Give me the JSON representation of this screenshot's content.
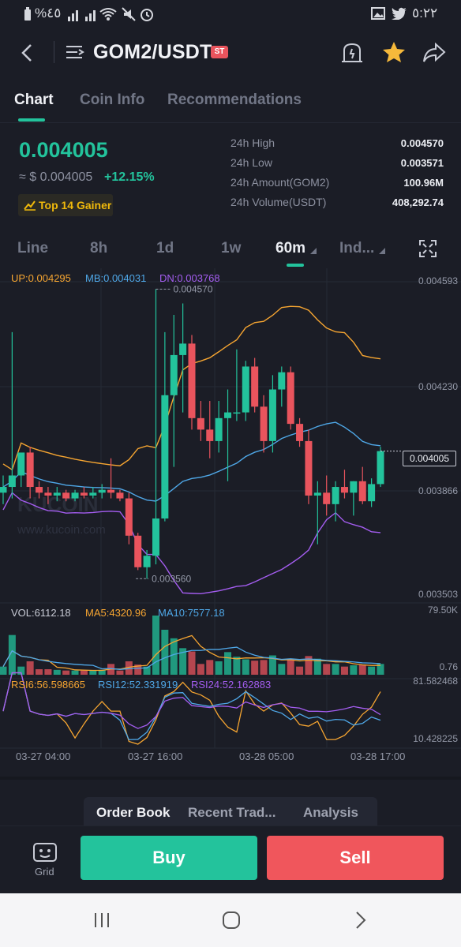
{
  "status_bar": {
    "left_text": "%٤٥",
    "time": "٥:٢٢"
  },
  "header": {
    "pair": "GOM2/USDT",
    "badge": "ST"
  },
  "tabs": [
    {
      "label": "Chart",
      "active": true
    },
    {
      "label": "Coin Info",
      "active": false
    },
    {
      "label": "Recommendations",
      "active": false
    }
  ],
  "ticker": {
    "price": "0.004005",
    "fiat": "≈ $ 0.004005",
    "change": "+12.15%",
    "gainer_label": "Top 14 Gainer"
  },
  "stats": [
    {
      "label": "24h High",
      "value": "0.004570"
    },
    {
      "label": "24h Low",
      "value": "0.003571"
    },
    {
      "label": "24h Amount(GOM2)",
      "value": "100.96M"
    },
    {
      "label": "24h Volume(USDT)",
      "value": "408,292.74"
    }
  ],
  "intervals": [
    {
      "label": "Line",
      "active": false
    },
    {
      "label": "8h",
      "active": false
    },
    {
      "label": "1d",
      "active": false
    },
    {
      "label": "1w",
      "active": false
    },
    {
      "label": "60m",
      "active": true
    },
    {
      "label": "Ind...",
      "active": false
    }
  ],
  "chart": {
    "boll_up": "UP:0.004295",
    "boll_mb": "MB:0.004031",
    "boll_dn": "DN:0.003768",
    "y_axis": [
      "0.004593",
      "0.004230",
      "0.003866",
      "0.003503"
    ],
    "current_price_tag": "0.004005",
    "high_marker": "0.004570",
    "low_marker": "0.003560",
    "watermark_logo": "KUCOIN",
    "watermark_url": "www.kucoin.com",
    "vol": "VOL:6112.18",
    "ma5": "MA5:4320.96",
    "ma10": "MA10:7577.18",
    "vol_axis_top": "79.50K",
    "vol_axis_bottom": "0.76",
    "rsi6": "RSI6:56.598665",
    "rsi12": "RSI12:52.331919",
    "rsi24": "RSI24:52.162883",
    "rsi_axis_top": "81.582468",
    "rsi_axis_bottom": "10.428225",
    "time_labels": [
      "03-27 04:00",
      "03-27 16:00",
      "03-28 05:00",
      "03-28 17:00"
    ]
  },
  "bottom_tabs": [
    {
      "label": "Order Book",
      "active": true
    },
    {
      "label": "Recent Trad...",
      "active": false
    },
    {
      "label": "Analysis",
      "active": false
    }
  ],
  "actions": {
    "grid_label": "Grid",
    "buy_label": "Buy",
    "sell_label": "Sell"
  },
  "colors": {
    "up": "#23c39c",
    "down": "#e9545d",
    "boll_up": "#f6a531",
    "boll_mb": "#4fa8e8",
    "boll_dn": "#a45df0",
    "background": "#1b1d26"
  },
  "chart_data": {
    "type": "candlestick",
    "y_range": [
      0.003503,
      0.004593
    ],
    "candles": [
      {
        "o": 0.00386,
        "h": 0.00392,
        "l": 0.00382,
        "c": 0.00388
      },
      {
        "o": 0.00388,
        "h": 0.00442,
        "l": 0.00384,
        "c": 0.00392
      },
      {
        "o": 0.00392,
        "h": 0.00398,
        "l": 0.00388,
        "c": 0.004
      },
      {
        "o": 0.004,
        "h": 0.00402,
        "l": 0.00384,
        "c": 0.00388
      },
      {
        "o": 0.00388,
        "h": 0.0039,
        "l": 0.00384,
        "c": 0.00386
      },
      {
        "o": 0.00386,
        "h": 0.00388,
        "l": 0.00382,
        "c": 0.00385
      },
      {
        "o": 0.00385,
        "h": 0.00388,
        "l": 0.00383,
        "c": 0.00386
      },
      {
        "o": 0.00386,
        "h": 0.00387,
        "l": 0.00383,
        "c": 0.00384
      },
      {
        "o": 0.00384,
        "h": 0.00387,
        "l": 0.00383,
        "c": 0.00386
      },
      {
        "o": 0.00386,
        "h": 0.00388,
        "l": 0.00384,
        "c": 0.00385
      },
      {
        "o": 0.00385,
        "h": 0.00388,
        "l": 0.00384,
        "c": 0.00386
      },
      {
        "o": 0.00386,
        "h": 0.00389,
        "l": 0.00384,
        "c": 0.00387
      },
      {
        "o": 0.00387,
        "h": 0.00398,
        "l": 0.00384,
        "c": 0.00386
      },
      {
        "o": 0.00386,
        "h": 0.00387,
        "l": 0.00383,
        "c": 0.00384
      },
      {
        "o": 0.00384,
        "h": 0.00386,
        "l": 0.00368,
        "c": 0.00371
      },
      {
        "o": 0.00371,
        "h": 0.00372,
        "l": 0.00359,
        "c": 0.0036
      },
      {
        "o": 0.0036,
        "h": 0.00366,
        "l": 0.00356,
        "c": 0.00364
      },
      {
        "o": 0.00364,
        "h": 0.00457,
        "l": 0.00361,
        "c": 0.00377
      },
      {
        "o": 0.00377,
        "h": 0.00442,
        "l": 0.00376,
        "c": 0.0042
      },
      {
        "o": 0.0042,
        "h": 0.00448,
        "l": 0.00395,
        "c": 0.00434
      },
      {
        "o": 0.00434,
        "h": 0.00452,
        "l": 0.00414,
        "c": 0.00438
      },
      {
        "o": 0.00438,
        "h": 0.00441,
        "l": 0.00408,
        "c": 0.00412
      },
      {
        "o": 0.00412,
        "h": 0.00418,
        "l": 0.00404,
        "c": 0.00408
      },
      {
        "o": 0.00408,
        "h": 0.00418,
        "l": 0.00398,
        "c": 0.00404
      },
      {
        "o": 0.00404,
        "h": 0.00418,
        "l": 0.004,
        "c": 0.00412
      },
      {
        "o": 0.00412,
        "h": 0.00422,
        "l": 0.0039,
        "c": 0.00414
      },
      {
        "o": 0.00414,
        "h": 0.00436,
        "l": 0.00411,
        "c": 0.00414
      },
      {
        "o": 0.00414,
        "h": 0.00432,
        "l": 0.00411,
        "c": 0.0043
      },
      {
        "o": 0.0043,
        "h": 0.00433,
        "l": 0.00414,
        "c": 0.00416
      },
      {
        "o": 0.00416,
        "h": 0.0042,
        "l": 0.004,
        "c": 0.00404
      },
      {
        "o": 0.00404,
        "h": 0.00427,
        "l": 0.004,
        "c": 0.00422
      },
      {
        "o": 0.00422,
        "h": 0.0043,
        "l": 0.00416,
        "c": 0.00428
      },
      {
        "o": 0.00428,
        "h": 0.0043,
        "l": 0.00408,
        "c": 0.0041
      },
      {
        "o": 0.0041,
        "h": 0.00412,
        "l": 0.00402,
        "c": 0.00404
      },
      {
        "o": 0.00404,
        "h": 0.00408,
        "l": 0.00382,
        "c": 0.00385
      },
      {
        "o": 0.00385,
        "h": 0.0039,
        "l": 0.00368,
        "c": 0.00386
      },
      {
        "o": 0.00386,
        "h": 0.00392,
        "l": 0.00378,
        "c": 0.00382
      },
      {
        "o": 0.00382,
        "h": 0.0039,
        "l": 0.00376,
        "c": 0.00388
      },
      {
        "o": 0.00388,
        "h": 0.00394,
        "l": 0.00384,
        "c": 0.00386
      },
      {
        "o": 0.00386,
        "h": 0.0039,
        "l": 0.00378,
        "c": 0.0039
      },
      {
        "o": 0.0039,
        "h": 0.00395,
        "l": 0.00382,
        "c": 0.00383
      },
      {
        "o": 0.00383,
        "h": 0.00391,
        "l": 0.00381,
        "c": 0.00389
      },
      {
        "o": 0.00389,
        "h": 0.00402,
        "l": 0.00388,
        "c": 0.004005
      }
    ]
  }
}
